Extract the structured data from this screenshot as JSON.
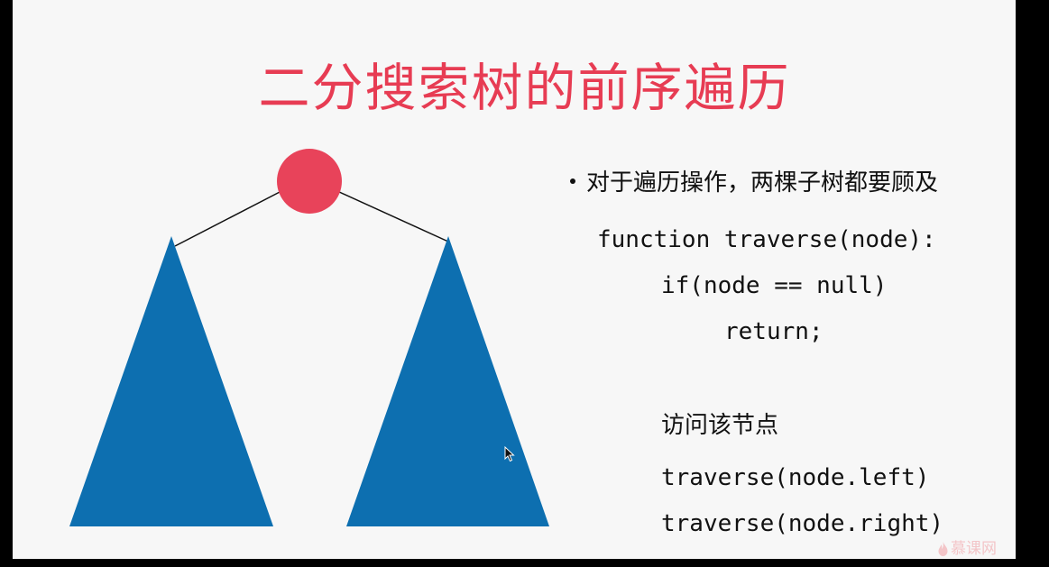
{
  "title": "二分搜索树的前序遍历",
  "colors": {
    "title": "#e73c53",
    "root_node": "#e8435a",
    "subtree": "#0d6fb0",
    "edge": "#111111",
    "slide_background": "#f7f7f7",
    "frame_background": "#000000"
  },
  "diagram": {
    "root_node": "root-node",
    "left_subtree": "left-subtree",
    "right_subtree": "right-subtree"
  },
  "bullet": {
    "text": "对于遍历操作，两棵子树都要顾及"
  },
  "code": {
    "line1": "function traverse(node):",
    "line2": "if(node == null)",
    "line3": "return;",
    "comment": "访问该节点",
    "line4": "traverse(node.left)",
    "line5": "traverse(node.right)"
  },
  "icons": {
    "cursor": "mouse-cursor-icon",
    "watermark": "flame-logo-icon"
  },
  "watermark": {
    "text": "慕课网"
  }
}
